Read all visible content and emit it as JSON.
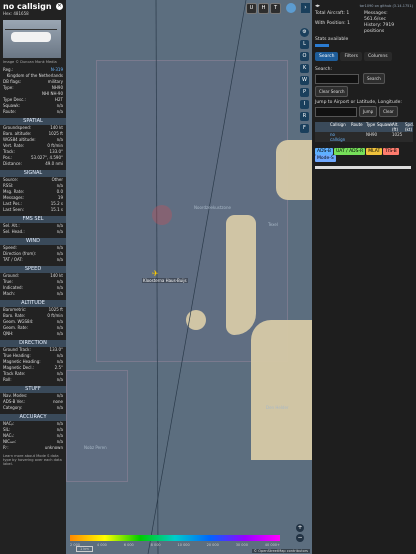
{
  "left": {
    "callsign": "no callsign",
    "hex": "Hex: 481658",
    "photo_credit": "Image © Duncan Monk Media",
    "reg_label": "Reg.:",
    "reg_value": "N-319",
    "country": "Kingdom of the Netherlands",
    "rows_top": [
      {
        "k": "DB flags:",
        "v": "military"
      },
      {
        "k": "Type:",
        "v": "NH90"
      },
      {
        "k": "",
        "v": "NHI NH-90"
      },
      {
        "k": "Type Desc.:",
        "v": "H2T"
      },
      {
        "k": "Squawk:",
        "v": "n/a"
      },
      {
        "k": "Route:",
        "v": "n/a"
      }
    ],
    "spatial_title": "SPATIAL",
    "spatial": [
      {
        "k": "Groundspeed:",
        "v": "140 kt"
      },
      {
        "k": "Baro. altitude:",
        "v": "1025 ft"
      },
      {
        "k": "WGS84 altitude:",
        "v": "n/a"
      },
      {
        "k": "Vert. Rate:",
        "v": "0 ft/min"
      },
      {
        "k": "Track:",
        "v": "133.0°"
      },
      {
        "k": "Pos.:",
        "v": "53.027°, 4.590°"
      },
      {
        "k": "Distance:",
        "v": "49.0 nmi"
      }
    ],
    "signal_title": "SIGNAL",
    "signal": [
      {
        "k": "Source:",
        "v": "Other"
      },
      {
        "k": "RSSI:",
        "v": "n/a"
      },
      {
        "k": "Msg. Rate:",
        "v": "0.0"
      },
      {
        "k": "Messages:",
        "v": "19"
      },
      {
        "k": "Last Pos.:",
        "v": "15.2 s"
      },
      {
        "k": "Last Seen:",
        "v": "15.1 s"
      }
    ],
    "fms_title": "FMS SEL",
    "fms": [
      {
        "k": "Sel. Alt.:",
        "v": "n/a"
      },
      {
        "k": "Sel. Head.:",
        "v": "n/a"
      }
    ],
    "wind_title": "WIND",
    "wind": [
      {
        "k": "Speed:",
        "v": "n/a"
      },
      {
        "k": "Direction (from):",
        "v": "n/a"
      },
      {
        "k": "TAT / OAT:",
        "v": "n/a"
      }
    ],
    "speed_title": "SPEED",
    "speed": [
      {
        "k": "Ground:",
        "v": "140 kt"
      },
      {
        "k": "True:",
        "v": "n/a"
      },
      {
        "k": "Indicated:",
        "v": "n/a"
      },
      {
        "k": "Mach:",
        "v": "n/a"
      }
    ],
    "altitude_title": "ALTITUDE",
    "altitude": [
      {
        "k": "Barometric:",
        "v": "1025 ft"
      },
      {
        "k": "Baro. Rate:",
        "v": "0 ft/min"
      },
      {
        "k": "Geom. WGS84:",
        "v": "n/a"
      },
      {
        "k": "Geom. Rate:",
        "v": "n/a"
      },
      {
        "k": "QNH:",
        "v": "n/a"
      }
    ],
    "direction_title": "DIRECTION",
    "direction": [
      {
        "k": "Ground Track:",
        "v": "133.0°"
      },
      {
        "k": "True Heading:",
        "v": "n/a"
      },
      {
        "k": "Magnetic Heading:",
        "v": "n/a"
      },
      {
        "k": "Magnetic Decl.:",
        "v": "2.5°"
      },
      {
        "k": "Track Rate:",
        "v": "n/a"
      },
      {
        "k": "Roll:",
        "v": "n/a"
      }
    ],
    "stuff_title": "STUFF",
    "stuff": [
      {
        "k": "Nav. Modes:",
        "v": "n/a"
      },
      {
        "k": "ADS-B Ver.:",
        "v": "none"
      },
      {
        "k": "Category:",
        "v": "n/a"
      }
    ],
    "accuracy_title": "ACCURACY",
    "accuracy": [
      {
        "k": "NACₚ:",
        "v": "n/a"
      },
      {
        "k": "SIL:",
        "v": "n/a"
      },
      {
        "k": "NACᵥ:",
        "v": "n/a"
      },
      {
        "k": "NICₐₐ₀:",
        "v": "n/a"
      },
      {
        "k": "Rᶜ:",
        "v": "unknown"
      }
    ],
    "learn": "Learn more about Mode S data type by hovering over each data label."
  },
  "map": {
    "labels": {
      "noordzee": "Noordzeekustzone",
      "texel": "Texel",
      "den_helder": "Den Helder",
      "nobz": "Nobz Peren",
      "callsign_tag": "Kloosterna Haus-Buijs"
    },
    "top_buttons": [
      "U",
      "H",
      "T"
    ],
    "right_buttons": [
      "L",
      "O",
      "K",
      "W",
      "P",
      "I",
      "R",
      "F"
    ],
    "legend_ticks": [
      "2 000",
      "4 000",
      "6 000",
      "8 000",
      "10 000",
      "20 000",
      "30 000",
      "40 000+"
    ],
    "scale": "1 km",
    "attribution": "© OpenStreetMap contributors"
  },
  "right": {
    "top_link": "tar1090 on github (3.14.1751)",
    "total_aircraft_label": "Total Aircraft:",
    "total_aircraft_value": "1",
    "with_position_label": "With Position:",
    "with_position_value": "1",
    "messages_label": "Messages:",
    "messages_value": "561.6/sec",
    "history_label": "History:",
    "history_value": "7919 positions",
    "stats_link": "Stats available",
    "tabs": [
      "Search",
      "Filters",
      "Columns"
    ],
    "search_label": "Search:",
    "search_button": "Search",
    "clear_search": "Clear Search",
    "jump_label": "Jump to Airport or Latitude, Longitude:",
    "jump_button": "Jump",
    "clear_button": "Clear",
    "table_headers": [
      "",
      "Callsign",
      "Route",
      "Type",
      "Squawk",
      "Alt. (ft)",
      "Spd. (kt)"
    ],
    "table_row": [
      "",
      "no callsign",
      "",
      "NH90",
      "",
      "1025",
      ""
    ],
    "tags": [
      {
        "text": "ADS-B",
        "color": "#5fb0ff"
      },
      {
        "text": "UAT / ADS-R",
        "color": "#76e05a"
      },
      {
        "text": "MLAT",
        "color": "#f0c23c"
      },
      {
        "text": "TIS-B",
        "color": "#ff7c6e"
      },
      {
        "text": "Mode-S",
        "color": "#6fa8ff"
      }
    ]
  }
}
